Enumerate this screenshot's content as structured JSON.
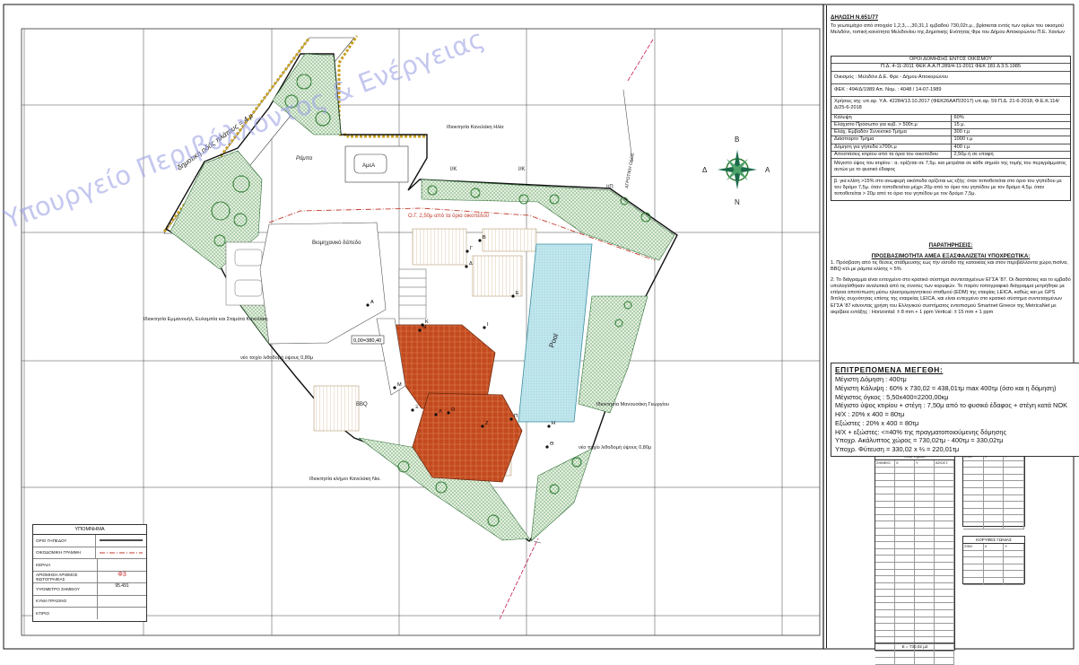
{
  "plan": {
    "road_label": "δημοτική οδός πλάτους = 4 μ",
    "rampa": "Ράμπα",
    "car": "ΑμεΑ",
    "paved": "Βιομηχανικό δάπεδο",
    "pool": "Pool",
    "setback": "Ο.Γ. 2,50μ από τα όρια οικοπέδου",
    "owner_top": "Ιδιοκτησία Κανελάκη Ηλία",
    "owner_left": "Ιδιοκτησία Εμμανουήλ, Ευλαμπία και Σταμάτα Κανελάκη",
    "owner_right": "Ιδιοκτησία Μανουσάκη Γεωργίου",
    "owner_bottom": "Ιδιοκτησία κλήμοι Κανελάκη Νικ.",
    "wall_left": "νέο τοιχίο λιθοδομή ύψους 0,80μ",
    "wall_right": "νέο τοιχίο λιθοδομή ύψους 0,80μ",
    "level": "0,00=380,40",
    "bbq": "BBQ",
    "ik1": "Ι/Κ",
    "ik2": "Ι/Κ",
    "ik3": "Ι/Π",
    "road_right": "ΑΓΡΟΤΙΚΗ ΟΔΟΣ",
    "watermark": "Υπουργείο Περιβάλλοντος & Ενέργειας",
    "compass": {
      "n": "Β",
      "s": "Ν",
      "e": "Α",
      "w": "Δ"
    },
    "points": [
      "Α",
      "Β",
      "Γ",
      "Δ",
      "Ε",
      "Ζ",
      "Η",
      "Θ",
      "Ι",
      "Κ",
      "Λ",
      "Μ",
      "Ν",
      "Ξ",
      "Ο",
      "Π"
    ]
  },
  "legend": {
    "title": "ΥΠΟΜΝΗΜΑ",
    "items": [
      "ΟΡΙΟ ΓΗΠΕΔΟΥ",
      "ΟΙΚΟΔΟΜΙΚΗ ΓΡΑΜΜΗ",
      "ΚΕΡΑΙΑ",
      "ΑΡΙΘΜΗΣΗ ΑΡΙΘΜΟΣ ΦΩΤΟΓΡΑΦΙΑΣ",
      "ΥΨΟΜΕΤΡΟ ΣΗΜΕΙΟΥ",
      "ΚΥΜΑ ΠΡΑΣΙΝΟ",
      "ΚΤΙΡΙΟ"
    ],
    "photo_sym": "Φ3",
    "level_sym": "95.491"
  },
  "panel": {
    "decl_title": "ΔΗΛΩΣΗ Ν.651/77",
    "decl_text": "Το γεωτεμάχιο από στοιχεία 1,2,3,...,30,31,1 εμβαδού 730,02τ.μ., βρίσκεται εντός των ορίων του οικισμού Μελιδόνι, τοπική κοινότητα Μελιδονίου της Δημοτικής Ενότητας Φρε του Δήμου Αποκορώνου Π.Ε. Χανίων",
    "terms_title": "ΟΡΟΙ ΔΟΜΗΣΗΣ ΕΝΤΟΣ ΟΙΚΙΣΜΟΥ",
    "terms_ref": "Π.Δ. 4-11-2011 ΦΕΚ Α.Α.Π.289/4-11-2011      ΦΕΚ 181 Δ 3.5.1985",
    "settlement": "Οικισμός : Μελιδόνι Δ.Ε. Φρε - Δήμου Αποκορώνου",
    "fek": "ΦΕΚ : 494/Δ/1989   Απ. Νομ. : 4048 / 14-07-1989",
    "use": "Χρήσεις ισχ: υπ.αρ. Υ.Α. 42284/13.10.2017 (ΦΕΚ26ΑΑΠ/2017) υπ.αρ. 59 Π.Δ. 21-6-2018, Φ.Ε.Κ.114/Δ/25-6-2018",
    "terms": [
      [
        "Κάλυψη",
        "60%"
      ],
      [
        "Ελάχιστο Πρόσωπο για κυβ. > 500τ.μ",
        "15 μ."
      ],
      [
        "Ελάχ. Εμβαδόν Συνεκτικό Τμήμα",
        "300 τ.μ"
      ],
      [
        "Διάσπαρτο Τμήμα",
        "1000 τ.μ"
      ],
      [
        "Δόμηση για γήπεδα ≥700τ.μ",
        "400 τ.μ"
      ],
      [
        "Αποστάσεις κτιρίου από τα όρια του οικοπέδου",
        "2,50μ ή σε επαφή"
      ]
    ],
    "height_note": "Μέγιστο ύψος του κτιρίου : α. ορίζεται σε 7,5μ. και μετράται σε κάθε σημείο της τομής του περιγράμματος αυτών με το φυσικό έδαφος",
    "height_note2": "β. για κλίση >15% στο ανωφερή οικόπεδα ορίζεται ως εξής: όταν τοποθετείται στο όριο του γηπέδου με τον δρόμο 7,5μ. όταν τοποθετείται μέχρι 20μ από το όριο του γηπέδου με τον δρόμο 4,5μ. όταν τοποθετείται > 20μ από το όριο του γηπέδου με τον δρόμο 7,5μ.",
    "remarks_title": "ΠΑΡΑΤΗΡΗΣΕΙΣ:",
    "access_title": "ΠΡΟΣΒΑΣΙΜΟΤΗΤΑ ΑΜΕΑ ΕΞΑΣΦΑΛΙΖΕΤΑΙ ΥΠΟΧΡΕΩΤΙΚΑ:",
    "access_text": "1. Πρόσβαση από τις θέσεις στάθμευσης έως την είσοδο της κατοικίας και στον περιβάλλοντα χώρο,πισίνα, BBQ κτλ.με ράμπα κλίσης < 5%",
    "survey_text": "2. Το διάγραμμα είναι εντεγμένο στο κρατικό σύστημα συντεταγμένων ΕΓΣΑ '87. Οι διαστάσεις και το εμβαδό υπολογίσθηκαν αναλυτικά από τις συνιτες των κορυφών. Το παρόν τοπογραφικό διάγραμμα μετρήθηκε με επίγεια αποτύπωση μέσω ηλεκτρομαγνητικού σταθμού (EDM) της εταιρίας LEICA, καθώς και με GPS διπλής συχνότητας επίσης της εταιρείας LEICA, και είναι εντεγμένο στο κρατικό σύστημα συντεταγμένων ΕΓΣΑ '87 κάνοντας χρήση του Ελληνικού συστήματος εντοπισμού Smartnet Greece της MetricaNet με ακρίβεια εντάξης : Horizontal: ± 8 mm + 1 ppm  Vertical: ± 15 mm + 1 ppm",
    "permitted": {
      "title": "ΕΠΙΤΡΕΠΟΜΕΝΑ ΜΕΓΕΘΗ:",
      "lines": [
        "Μέγιστη Δόμηση : 400τμ",
        "Μέγιστη Κάλυψη : 60% x 730,02 = 438,01τμ max 400τμ (όσο και η δόμηση)",
        "Μέγιστος όγκος : 5,50x400=2200,00κμ",
        "Μέγιστο ύψος κτιρίου + στέγη : 7,50μ από το φυσικό έδαφος + στέγη κατά ΝΟΚ",
        "Η/Χ : 20% x 400 = 80τμ",
        "Εξώστες : 20% x 400 = 80τμ",
        "Η/Χ + εξώστες: <=40% της πραγματοποιούμενης δόμησης",
        "Υποχρ. Ακάλυπτος χώρος = 730,02τμ - 400τμ = 330,02τμ",
        "Υποχρ. Φύτευση = 330,02 x ⅔ = 220,01τμ"
      ]
    }
  },
  "tables": {
    "area_title": "ΕΜΒΑΔΟΜΕΤΡΗΣΗ ΓΗΠΕΔΟΥ",
    "area_sub": "Ονομ. Σημείων",
    "area_cols": [
      "ΣΗΜΕΙΟ",
      "Χ",
      "Υ",
      "ΑΠΟΣΤ."
    ],
    "area_total": "Ε = 730,02 μ2",
    "vert_title": "ΚΟΡΥΦΕΣ ΚΤΙΡΙΟΥ",
    "vert_cols": [
      "ΣΗΜ",
      "Χ",
      "Υ"
    ],
    "corner_title": "ΚΟΡΥΦΕΣ ΓΩΝΙΑΣ",
    "corner_cols": [
      "ΣΗΜ",
      "Χ",
      "Υ"
    ]
  }
}
